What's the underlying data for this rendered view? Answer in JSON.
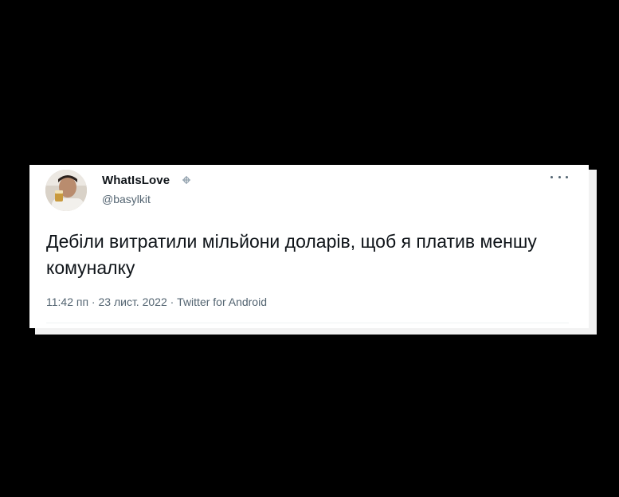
{
  "tweet": {
    "display_name": "WhatIsLove",
    "handle": "@basylkit",
    "badge_icon": "pin-badge-icon",
    "more_icon": "more-options-icon",
    "text": "Дебіли витратили мільйони доларів, щоб я платив меншу комуналку",
    "meta": "11:42 пп · 23 лист. 2022 · Twitter for Android"
  },
  "colors": {
    "background": "#000000",
    "card": "#ffffff",
    "primary_text": "#0f1419",
    "secondary_text": "#536471"
  }
}
